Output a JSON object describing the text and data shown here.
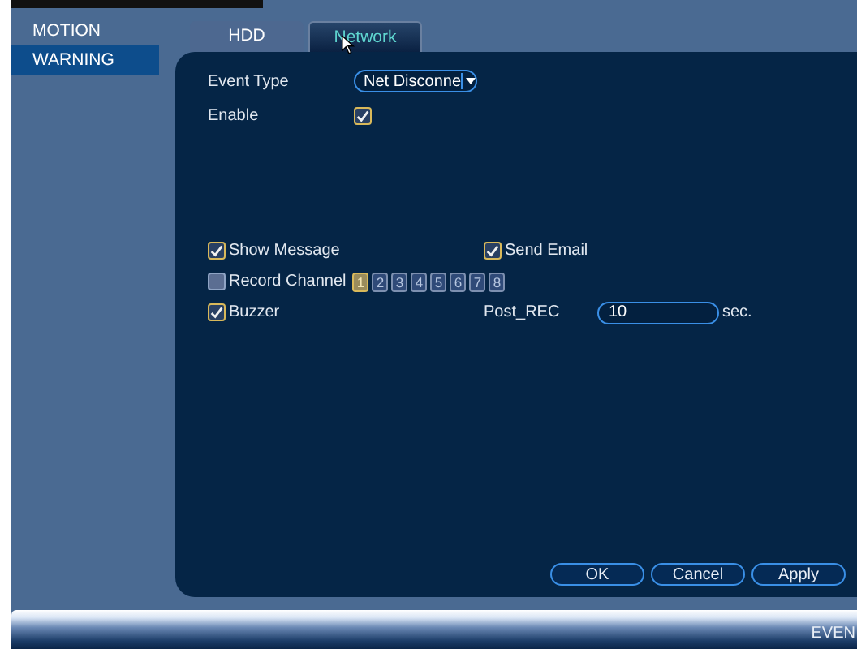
{
  "sidebar": {
    "items": [
      {
        "label": "MOTION",
        "selected": false
      },
      {
        "label": "WARNING",
        "selected": true
      }
    ]
  },
  "tabs": [
    {
      "label": "HDD",
      "selected": false
    },
    {
      "label": "Network",
      "selected": true
    }
  ],
  "event_type": {
    "label": "Event Type",
    "value": "Net Disconne"
  },
  "enable": {
    "label": "Enable",
    "checked": true
  },
  "show_message": {
    "label": "Show Message",
    "checked": true
  },
  "send_email": {
    "label": "Send Email",
    "checked": true
  },
  "record_channel": {
    "label": "Record Channel",
    "checked": false,
    "channels": [
      {
        "label": "1",
        "selected": true
      },
      {
        "label": "2",
        "selected": false
      },
      {
        "label": "3",
        "selected": false
      },
      {
        "label": "4",
        "selected": false
      },
      {
        "label": "5",
        "selected": false
      },
      {
        "label": "6",
        "selected": false
      },
      {
        "label": "7",
        "selected": false
      },
      {
        "label": "8",
        "selected": false
      }
    ]
  },
  "buzzer": {
    "label": "Buzzer",
    "checked": true
  },
  "post_rec": {
    "label": "Post_REC",
    "value": "10",
    "unit": "sec."
  },
  "buttons": [
    "OK",
    "Cancel",
    "Apply"
  ],
  "bottom_bar": {
    "text": "EVEN"
  }
}
